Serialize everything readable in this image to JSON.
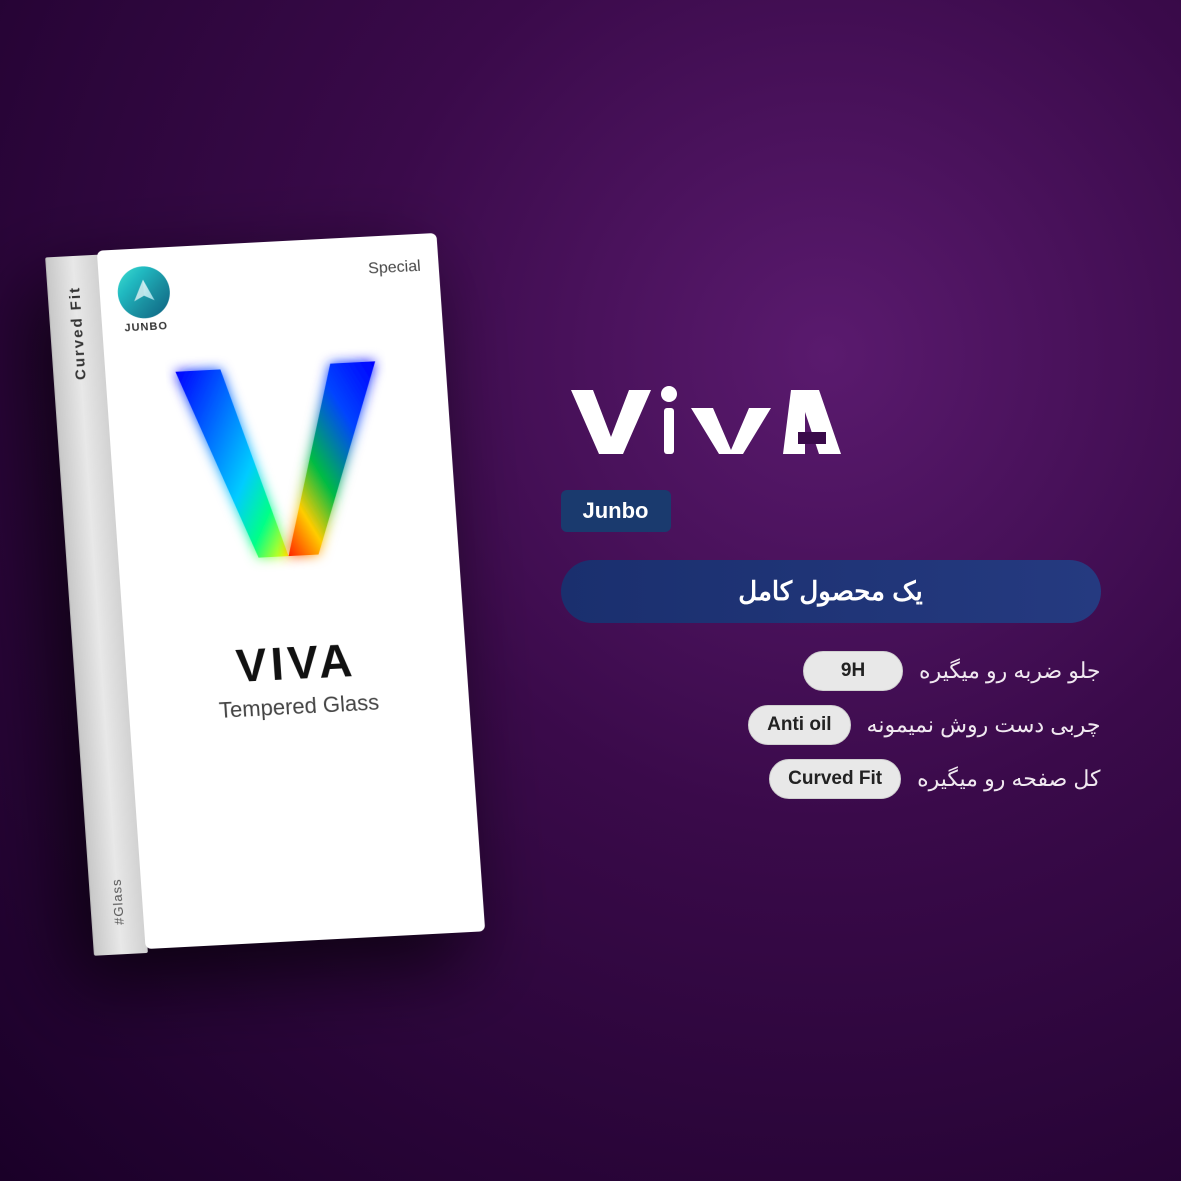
{
  "background": {
    "gradient": "radial purple dark"
  },
  "box": {
    "side_text_top": "Curved Fit",
    "side_text_bottom": "#Glass",
    "logo_brand": "JUNBO",
    "special_label": "Special",
    "viva_brand": "VIVA",
    "tempered_glass": "Tempered Glass"
  },
  "right_panel": {
    "viva_logo": "VIVA",
    "junbo_badge": "Junbo",
    "full_product_label": "یک محصول کامل",
    "features": [
      {
        "badge": "9H",
        "description": "جلو ضربه رو میگیره"
      },
      {
        "badge": "Anti oil",
        "description": "چربی دست روش نمیمونه"
      },
      {
        "badge": "Curved Fit",
        "description": "کل صفحه رو میگیره"
      }
    ]
  }
}
